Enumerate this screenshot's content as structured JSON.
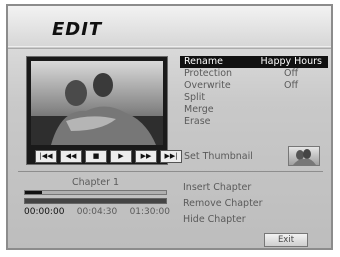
{
  "screen": {
    "title": "EDIT"
  },
  "transport": [
    "|◀◀",
    "◀◀",
    "■",
    "▶",
    "▶▶",
    "▶▶|"
  ],
  "menu": [
    {
      "label": "Rename",
      "value": "Happy Hours",
      "selected": true
    },
    {
      "label": "Protection",
      "value": "Off",
      "selected": false
    },
    {
      "label": "Overwrite",
      "value": "Off",
      "selected": false
    },
    {
      "label": "Split",
      "value": "",
      "selected": false
    },
    {
      "label": "Merge",
      "value": "",
      "selected": false
    },
    {
      "label": "Erase",
      "value": "",
      "selected": false
    }
  ],
  "thumbnail": {
    "label": "Set Thumbnail"
  },
  "chapter": {
    "label": "Chapter 1",
    "progress_top": 0.12,
    "progress_bottom": 1.0,
    "time_current": "00:00:00",
    "time_chapter": "00:04:30",
    "time_total": "01:30:00"
  },
  "chapter_menu": [
    "Insert Chapter",
    "Remove Chapter",
    "Hide Chapter"
  ],
  "exit_label": "Exit"
}
